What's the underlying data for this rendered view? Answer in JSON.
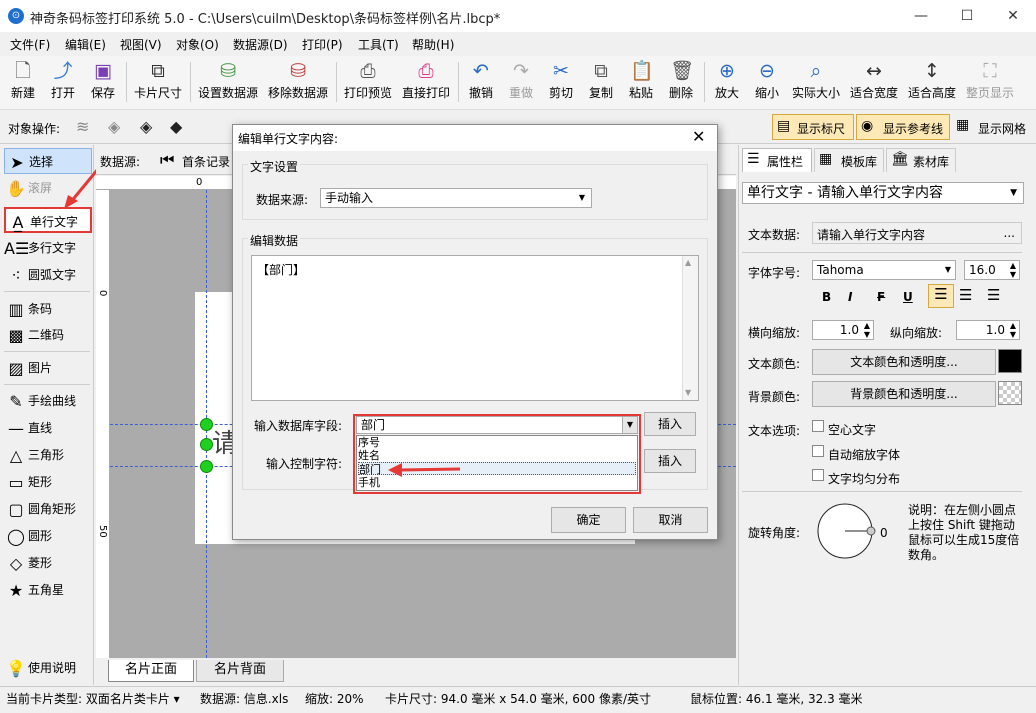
{
  "window": {
    "title": "神奇条码标签打印系统 5.0 - C:\\Users\\cuilm\\Desktop\\条码标签样例\\名片.lbcp*",
    "minimize": "—",
    "maximize": "☐",
    "close": "✕"
  },
  "menu": [
    "文件(F)",
    "编辑(E)",
    "视图(V)",
    "对象(O)",
    "数据源(D)",
    "打印(P)",
    "工具(T)",
    "帮助(H)"
  ],
  "toolbar": [
    "新建",
    "打开",
    "保存",
    "卡片尺寸",
    "设置数据源",
    "移除数据源",
    "打印预览",
    "直接打印",
    "撤销",
    "重做",
    "剪切",
    "复制",
    "粘贴",
    "删除",
    "放大",
    "缩小",
    "实际大小",
    "适合宽度",
    "适合高度",
    "整页显示"
  ],
  "objbar": {
    "label": "对象操作:",
    "show_ruler": "显示标尺",
    "show_guides": "显示参考线",
    "show_grid": "显示网格"
  },
  "datasource_bar": {
    "label": "数据源:",
    "first": "首条记录"
  },
  "left_tools": [
    "选择",
    "滚屏",
    "单行文字",
    "多行文字",
    "圆弧文字",
    "条码",
    "二维码",
    "图片",
    "手绘曲线",
    "直线",
    "三角形",
    "矩形",
    "圆角矩形",
    "圆形",
    "菱形",
    "五角星",
    "使用说明"
  ],
  "ruler": {
    "h0": "0",
    "v0": "0",
    "v50": "50"
  },
  "card_text": "请",
  "page_tabs": [
    "名片正面",
    "名片背面"
  ],
  "right_panel": {
    "tabs": [
      "属性栏",
      "模板库",
      "素材库"
    ],
    "object_select": "单行文字 - 请输入单行文字内容",
    "text_data_label": "文本数据:",
    "text_data_value": "请输入单行文字内容",
    "ellipsis": "...",
    "font_label": "字体字号:",
    "font_name": "Tahoma",
    "font_size": "16.0",
    "bold": "B",
    "italic": "I",
    "strike": "F",
    "underline": "U",
    "hscale_label": "横向缩放:",
    "hscale": "1.0",
    "vscale_label": "纵向缩放:",
    "vscale": "1.0",
    "text_color_label": "文本颜色:",
    "text_color_button": "文本颜色和透明度...",
    "bg_color_label": "背景颜色:",
    "bg_color_button": "背景颜色和透明度...",
    "text_options_label": "文本选项:",
    "option_hollow": "空心文字",
    "option_autoscale": "自动缩放字体",
    "option_even": "文字均匀分布",
    "rotation_label": "旋转角度:",
    "rotation_value": "0",
    "rotation_help": "说明：在左侧小圆点上按住 Shift 键拖动鼠标可以生成15度倍数角。"
  },
  "dialog": {
    "title": "编辑单行文字内容:",
    "group_text": "文字设置",
    "source_label": "数据来源:",
    "source_value": "手动输入",
    "group_edit": "编辑数据",
    "content": "【部门】",
    "db_field_label": "输入数据库字段:",
    "db_field_value": "部门",
    "db_options": [
      "序号",
      "姓名",
      "部门",
      "手机"
    ],
    "ctrl_label": "输入控制字符:",
    "insert": "插入",
    "insert2": "插入",
    "ok": "确定",
    "cancel": "取消"
  },
  "status": {
    "card_type": "当前卡片类型: 双面名片类卡片 ▾",
    "datasource": "数据源: 信息.xls",
    "zoom": "缩放: 20%",
    "card_size": "卡片尺寸: 94.0 毫米 x 54.0 毫米, 600 像素/英寸",
    "mouse": "鼠标位置: 46.1 毫米, 32.3 毫米"
  },
  "colors": {
    "highlight_red": "#e53935",
    "selection_blue": "#1e6fd0",
    "handle_green": "#1fd11f"
  }
}
